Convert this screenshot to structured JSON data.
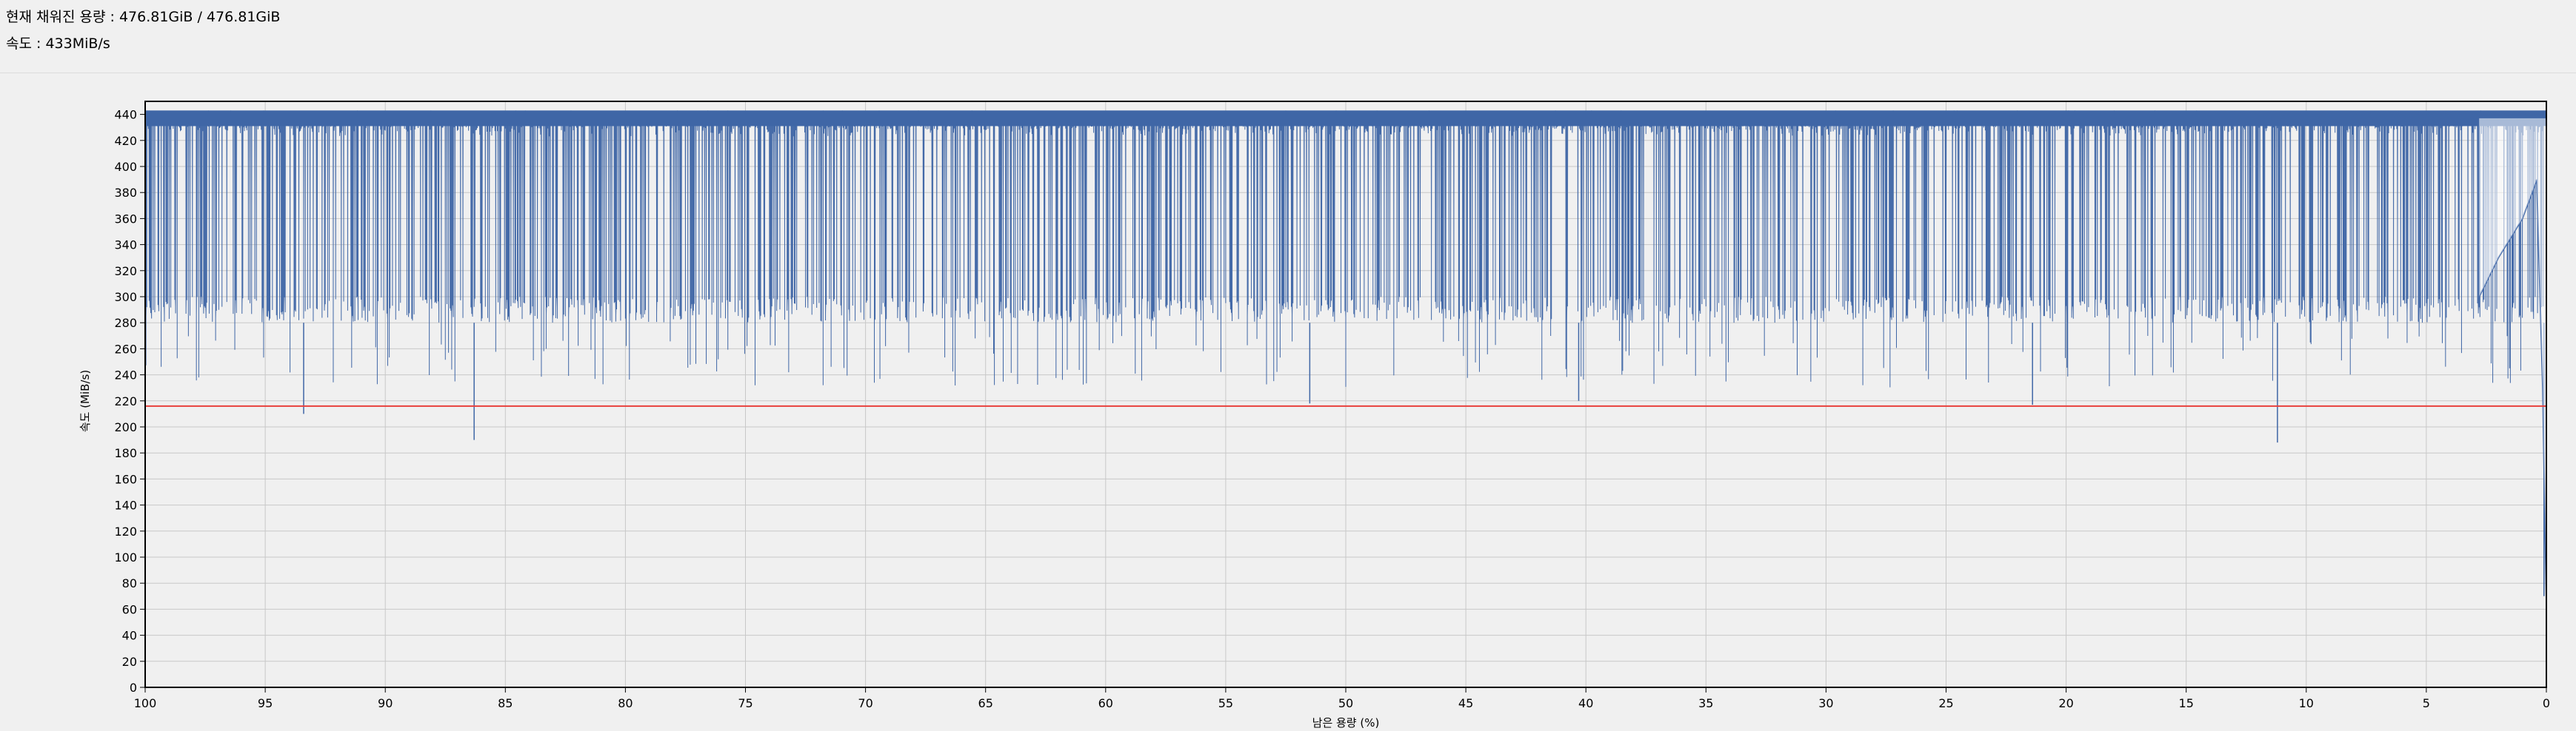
{
  "status": {
    "filled_label": "현재 채워진 용량",
    "filled_value": "476.81GiB / 476.81GiB",
    "speed_label": "속도",
    "speed_value": "433MiB/s"
  },
  "chart_data": {
    "type": "line",
    "xlabel": "남은 용량 (%)",
    "ylabel": "속도 (MiB/s)",
    "xlim": [
      100,
      0
    ],
    "ylim": [
      0,
      450
    ],
    "x_ticks": [
      100,
      95,
      90,
      85,
      80,
      75,
      70,
      65,
      60,
      55,
      50,
      45,
      40,
      35,
      30,
      25,
      20,
      15,
      10,
      5,
      0
    ],
    "y_ticks": [
      0,
      20,
      40,
      60,
      80,
      100,
      120,
      140,
      160,
      180,
      200,
      220,
      240,
      260,
      280,
      300,
      320,
      340,
      360,
      380,
      400,
      420,
      440
    ],
    "grid": true,
    "reference_line": {
      "y": 216,
      "color": "#e8403c"
    },
    "series": [
      {
        "color": "#3f66a6",
        "fill": "#8ea3c6",
        "upper_band": [
          437,
          443
        ],
        "lower_envelope": [
          280,
          300
        ],
        "typical_dip": [
          230,
          270
        ],
        "deep_dips": [
          {
            "x": 93.4,
            "y": 210
          },
          {
            "x": 86.3,
            "y": 190
          },
          {
            "x": 51.5,
            "y": 218
          },
          {
            "x": 40.3,
            "y": 220
          },
          {
            "x": 21.4,
            "y": 217
          },
          {
            "x": 11.2,
            "y": 188
          },
          {
            "x": 0.1,
            "y": 70
          }
        ],
        "tail": [
          {
            "x": 2.8,
            "y": 300
          },
          {
            "x": 2.0,
            "y": 330
          },
          {
            "x": 1.0,
            "y": 360
          },
          {
            "x": 0.4,
            "y": 390
          },
          {
            "x": 0.15,
            "y": 230
          },
          {
            "x": 0.05,
            "y": 120
          },
          {
            "x": 0.0,
            "y": 70
          }
        ]
      }
    ]
  }
}
